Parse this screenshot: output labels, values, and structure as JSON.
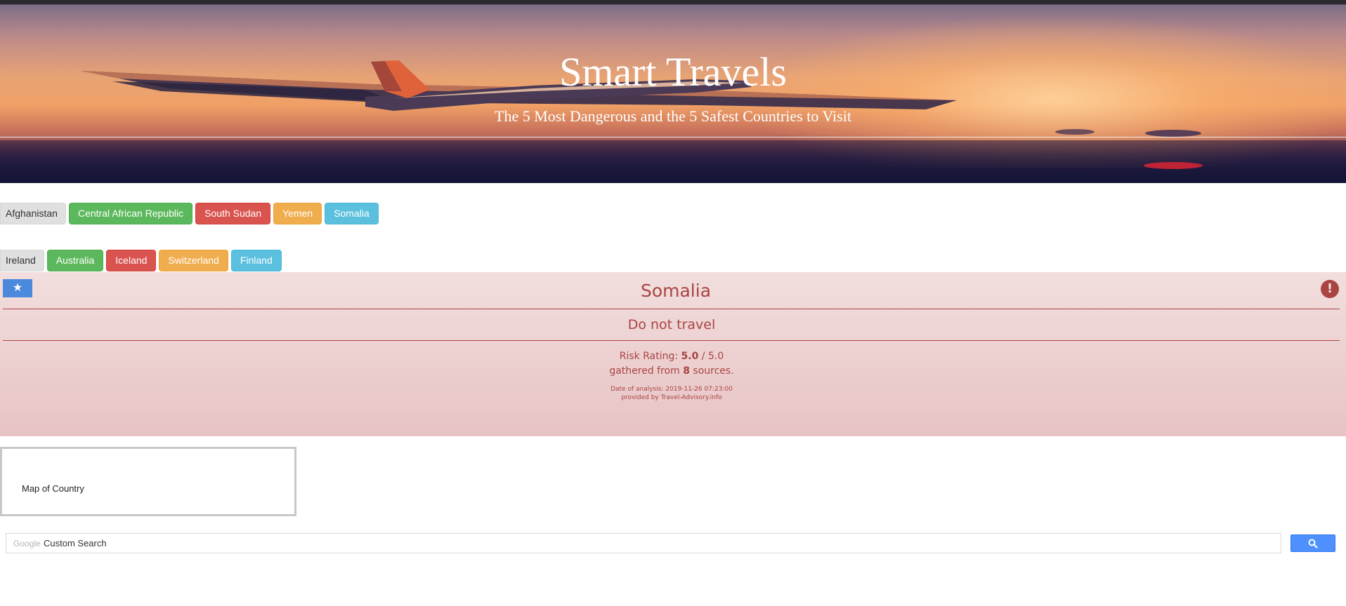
{
  "hero": {
    "title": "Smart Travels",
    "subtitle": "The 5 Most Dangerous and the 5 Safest Countries to Visit"
  },
  "dangerous_countries": [
    {
      "label": "Afghanistan",
      "style": "default"
    },
    {
      "label": "Central African Republic",
      "style": "success"
    },
    {
      "label": "South Sudan",
      "style": "danger"
    },
    {
      "label": "Yemen",
      "style": "warning"
    },
    {
      "label": "Somalia",
      "style": "info"
    }
  ],
  "safe_countries": [
    {
      "label": "Ireland",
      "style": "default"
    },
    {
      "label": "Australia",
      "style": "success"
    },
    {
      "label": "Iceland",
      "style": "danger"
    },
    {
      "label": "Switzerland",
      "style": "warning"
    },
    {
      "label": "Finland",
      "style": "info"
    }
  ],
  "advisory": {
    "favorite_icon": "star-icon",
    "alert_icon": "exclamation-circle-icon",
    "country": "Somalia",
    "status": "Do not travel",
    "rating_label": "Risk Rating:",
    "rating_value": "5.0",
    "rating_separator": "/",
    "rating_max": "5.0",
    "sources_prefix": "gathered from",
    "sources_count": "8",
    "sources_suffix": "sources.",
    "date_text": "Date of analysis: 2019-11-26 07:23:00",
    "provider_text": "provided by Travel-Advisory.info",
    "colors": {
      "text": "#a94442",
      "background": "#f2dede"
    }
  },
  "map": {
    "label": "Map of Country"
  },
  "search": {
    "brand": "Google",
    "placeholder": "Custom Search",
    "value": "",
    "button_icon": "search-icon",
    "button_color": "#4d90fe"
  }
}
